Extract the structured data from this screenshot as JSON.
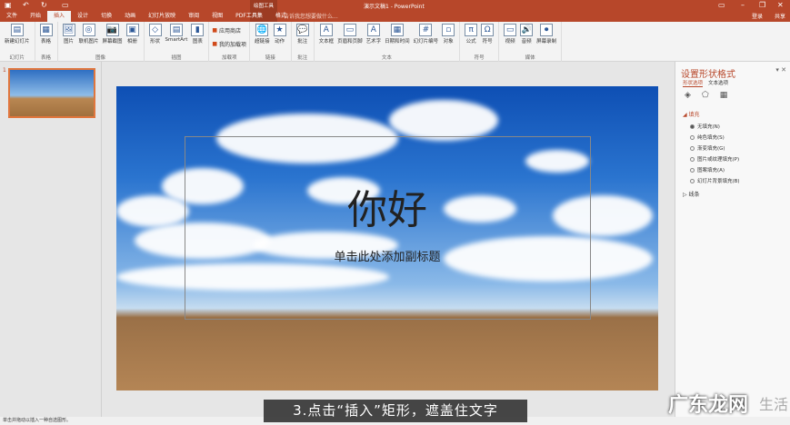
{
  "titlebar": {
    "title": "演示文稿1 - PowerPoint",
    "context_group": "绘图工具",
    "tell_me": "告诉我您想要做什么...",
    "login": "登录",
    "share": "共享"
  },
  "tabs": [
    "文件",
    "开始",
    "插入",
    "设计",
    "切换",
    "动画",
    "幻灯片放映",
    "审阅",
    "视图",
    "PDF工具集",
    "格式"
  ],
  "ribbon": {
    "groups": [
      {
        "label": "幻灯片",
        "buttons": [
          "新建幻灯片"
        ]
      },
      {
        "label": "表格",
        "buttons": [
          "表格"
        ]
      },
      {
        "label": "图像",
        "buttons": [
          "图片",
          "联机图片",
          "屏幕截图",
          "相册"
        ]
      },
      {
        "label": "插图",
        "buttons": [
          "形状",
          "SmartArt",
          "图表"
        ]
      },
      {
        "label": "加载项",
        "buttons": [
          "应用商店",
          "我的加载项"
        ]
      },
      {
        "label": "链接",
        "buttons": [
          "超链接",
          "动作"
        ]
      },
      {
        "label": "批注",
        "buttons": [
          "批注"
        ]
      },
      {
        "label": "文本",
        "buttons": [
          "文本框",
          "页眉和页脚",
          "艺术字",
          "日期和时间",
          "幻灯片编号",
          "对象"
        ]
      },
      {
        "label": "符号",
        "buttons": [
          "公式",
          "符号"
        ]
      },
      {
        "label": "媒体",
        "buttons": [
          "视频",
          "音频",
          "屏幕录制"
        ]
      }
    ]
  },
  "thumbs": {
    "number": "1"
  },
  "slide": {
    "title": "你好",
    "subtitle": "单击此处添加副标题"
  },
  "pane": {
    "title": "设置形状格式",
    "tabs": [
      "形状选项",
      "文本选项"
    ],
    "fill_header": "填充",
    "fill_options": [
      "无填充(N)",
      "纯色填充(S)",
      "渐变填充(G)",
      "图片或纹理填充(P)",
      "图案填充(A)",
      "幻灯片背景填充(B)"
    ],
    "line_header": "线条"
  },
  "status": "单击并拖动以插入一种自选图形。",
  "caption": "3.点击“插入”矩形，遮盖住文字",
  "watermark": "广东龙网"
}
